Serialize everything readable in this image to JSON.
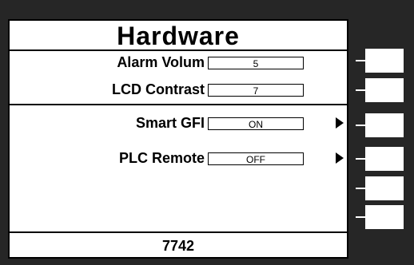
{
  "screen": {
    "title": "Hardware",
    "rows": [
      {
        "label": "Alarm Volum",
        "value": "5",
        "has_arrow": false
      },
      {
        "label": "LCD Contrast",
        "value": "7",
        "has_arrow": false
      },
      {
        "label": "Smart GFI",
        "value": "ON",
        "has_arrow": true
      },
      {
        "label": "PLC Remote",
        "value": "OFF",
        "has_arrow": true
      }
    ],
    "footer": "7742"
  },
  "softkeys": [
    "",
    "",
    "",
    "",
    "",
    ""
  ],
  "colors": {
    "bezel": "#262626",
    "screen": "#ffffff",
    "text": "#000000"
  }
}
